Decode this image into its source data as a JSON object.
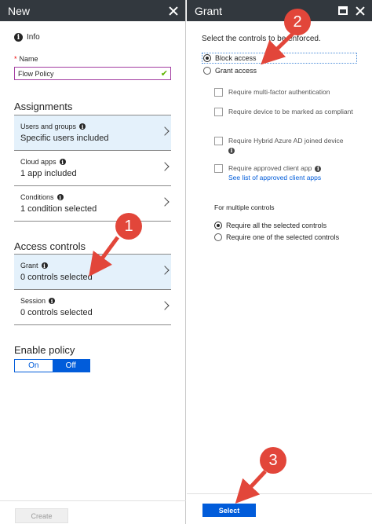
{
  "left_blade": {
    "title": "New",
    "info_label": "Info",
    "name_label": "Name",
    "name_value": "Flow Policy",
    "assignments_heading": "Assignments",
    "assignments": [
      {
        "label": "Users and groups",
        "value": "Specific users included"
      },
      {
        "label": "Cloud apps",
        "value": "1 app included"
      },
      {
        "label": "Conditions",
        "value": "1 condition selected"
      }
    ],
    "access_heading": "Access controls",
    "access": [
      {
        "label": "Grant",
        "value": "0 controls selected"
      },
      {
        "label": "Session",
        "value": "0 controls selected"
      }
    ],
    "enable_heading": "Enable policy",
    "toggle_on": "On",
    "toggle_off": "Off",
    "toggle_state": "Off",
    "create_label": "Create"
  },
  "right_blade": {
    "title": "Grant",
    "intro": "Select the controls to be enforced.",
    "block_access": "Block access",
    "grant_access": "Grant access",
    "selected_option": "Block access",
    "checkboxes": [
      {
        "label": "Require multi-factor authentication",
        "checked": false
      },
      {
        "label": "Require device to be marked as compliant",
        "checked": false
      },
      {
        "label": "Require Hybrid Azure AD joined device",
        "checked": false
      },
      {
        "label": "Require approved client app",
        "checked": false
      }
    ],
    "approved_apps_link": "See list of approved client apps",
    "multiple_heading": "For multiple controls",
    "require_all": "Require all the selected controls",
    "require_one": "Require one of the selected controls",
    "multiple_selected": "Require all the selected controls",
    "select_label": "Select"
  },
  "annotations": {
    "badge1": "1",
    "badge2": "2",
    "badge3": "3",
    "color": "#e2463a"
  },
  "colors": {
    "titlebar": "#32383e",
    "accent": "#015cda",
    "selected_row": "#e4f1fb",
    "name_border": "#a33ea1"
  }
}
